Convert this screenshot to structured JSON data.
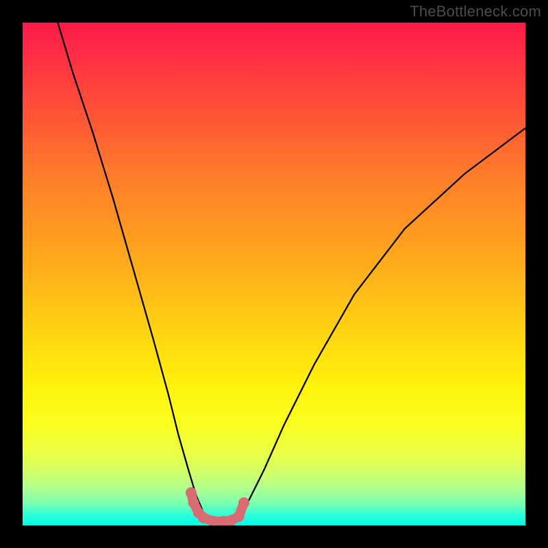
{
  "watermark": "TheBottleneck.com",
  "chart_data": {
    "type": "line",
    "title": "",
    "xlabel": "",
    "ylabel": "",
    "xlim": [
      0,
      100
    ],
    "ylim": [
      0,
      100
    ],
    "curve": {
      "x": [
        7,
        10,
        14,
        18,
        22,
        26,
        29,
        31,
        33,
        34.5,
        36,
        38,
        40,
        41.5,
        43,
        45,
        48,
        52,
        58,
        66,
        76,
        88,
        100
      ],
      "y": [
        100,
        90,
        78,
        65,
        51,
        37,
        26,
        18,
        11,
        6,
        2.5,
        1,
        0.8,
        1,
        2,
        5,
        11,
        20,
        32,
        46,
        59,
        70,
        79
      ]
    },
    "markers": {
      "x": [
        33.5,
        34,
        35,
        36,
        38,
        40,
        41.5,
        43,
        44
      ],
      "y": [
        6.5,
        4.5,
        2.5,
        1.5,
        0.8,
        0.8,
        1.0,
        1.8,
        4.5
      ]
    },
    "gradient_stops": [
      {
        "pct": 0,
        "color": "#ff1948"
      },
      {
        "pct": 18,
        "color": "#ff5336"
      },
      {
        "pct": 45,
        "color": "#ffa31e"
      },
      {
        "pct": 72,
        "color": "#fff20a"
      },
      {
        "pct": 90,
        "color": "#ccff6f"
      },
      {
        "pct": 100,
        "color": "#00ffe7"
      }
    ]
  }
}
